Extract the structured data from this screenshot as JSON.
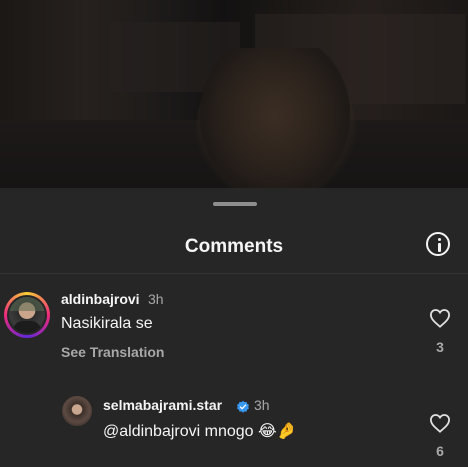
{
  "sheet": {
    "title": "Comments"
  },
  "comments": [
    {
      "username": "aldinbajrovi",
      "time": "3h",
      "text": "Nasikirala se",
      "see_translation": "See Translation",
      "likes": "3"
    }
  ],
  "replies": [
    {
      "username": "selmabajrami.star",
      "verified": true,
      "time": "3h",
      "text": "@aldinbajrovi mnogo 😂🤌",
      "likes": "6"
    }
  ],
  "icons": {
    "info": "info-icon",
    "like": "heart-outline-icon",
    "verified": "verified-badge-icon"
  },
  "colors": {
    "sheet_bg": "#262626",
    "secondary_text": "#a8a8a8",
    "verified_blue": "#3897f0"
  }
}
